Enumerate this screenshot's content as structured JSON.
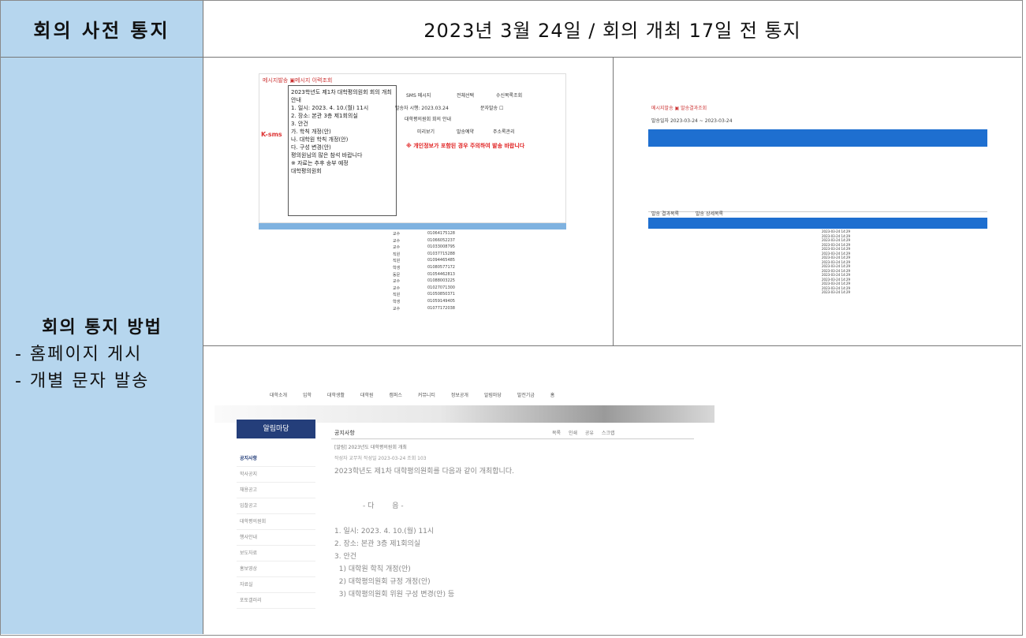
{
  "header": {
    "title": "회의 사전 통지",
    "notice": "2023년 3월 24일 / 회의 개최 17일 전 통지"
  },
  "side": {
    "title": "회의 통지 방법",
    "items": [
      "- 홈페이지 게시",
      "- 개별 문자 발송"
    ]
  },
  "shot1": {
    "tab": "메시지발송 ▣메시지 이력조회",
    "body": [
      "2023학년도 제1차 대학평의원회 회의 개최 안내",
      "1. 일시: 2023. 4. 10.(월) 11시",
      "2. 장소: 본관 3층 제1회의실",
      "3. 안건",
      " 가. 학칙 개정(안)",
      " 나. 대학원 학칙 개정(안)",
      " 다. 구성 변경(안)",
      "평의원님의 많은 참석 바랍니다",
      "※ 자료는 추후 송부 예정",
      "대학평의원회"
    ],
    "k_label": "K-sms",
    "field_a": "SMS 메시지",
    "field_b": "전체선택",
    "field_c": "수신목록조회",
    "field_d": "발송자 시행: 2023.03.24",
    "field_e": "문자발송 ☐",
    "field_f": "대학평의원회 회의 안내",
    "field_g": "미리보기",
    "field_h": "발송예약",
    "field_i": "주소록관리",
    "warning": "※ 개인정보가 포함된 경우 주의하여 발송 바랍니다",
    "rows": [
      [
        "교수",
        "01064175128"
      ],
      [
        "교수",
        "01066052237"
      ],
      [
        "교수",
        "01033008795"
      ],
      [
        "직원",
        "01037715288"
      ],
      [
        "직원",
        "01094465485"
      ],
      [
        "학생",
        "01080577172"
      ],
      [
        "동문",
        "01054462813"
      ],
      [
        "교수",
        "01088003225"
      ],
      [
        "교수",
        "01027071300"
      ],
      [
        "직원",
        "01050850371"
      ],
      [
        "학생",
        "01059149405"
      ],
      [
        "교수",
        "01077172038"
      ]
    ]
  },
  "shot2": {
    "menu": "메시지발송 ▣ 발송결과조회",
    "filter": "발송일자 2023-03-24 ~ 2023-03-24",
    "label_a": "발송 결과목록",
    "label_b": "발송 상세목록",
    "rows": [
      "2023-03-24 14:29",
      "2023-03-24 14:29",
      "2023-03-24 14:29",
      "2023-03-24 14:29",
      "2023-03-24 14:29",
      "2023-03-24 14:29",
      "2023-03-24 14:29",
      "2023-03-24 14:29",
      "2023-03-24 14:29",
      "2023-03-24 14:29",
      "2023-03-24 14:29",
      "2023-03-24 14:29",
      "2023-03-24 14:29",
      "2023-03-24 14:29",
      "2023-03-24 14:29"
    ]
  },
  "shot3": {
    "nav": "대학소개 입학 대학생활 대학원 캠퍼스 커뮤니티 정보공개 알림마당 발전기금 홈",
    "side_title": "알림마당",
    "side_items": [
      "공지사항",
      "학사공지",
      "채용공고",
      "입찰공고",
      "대학평의원회",
      "행사안내",
      "보도자료",
      "홍보영상",
      "자료실",
      "포토갤러리"
    ],
    "breadcrumb": "공지사항",
    "tools": "목록 인쇄 공유 스크랩",
    "post_title": "[알림] 2023년도 대학평의원회 개최",
    "meta": "작성자   교무처   작성일   2023-03-24   조회 103",
    "lead": "2023학년도 제1차 대학평의원회를 다음과 같이 개최합니다.",
    "center": "- 다        음 -",
    "items": [
      "1. 일시: 2023. 4. 10.(월) 11시",
      "2. 장소: 본관 3층 제1회의실",
      "3. 안건",
      "  1) 대학원 학칙 개정(안)",
      "  2) 대학평의원회 규정 개정(안)",
      "  3) 대학평의원회 위원 구성 변경(안) 등"
    ]
  }
}
